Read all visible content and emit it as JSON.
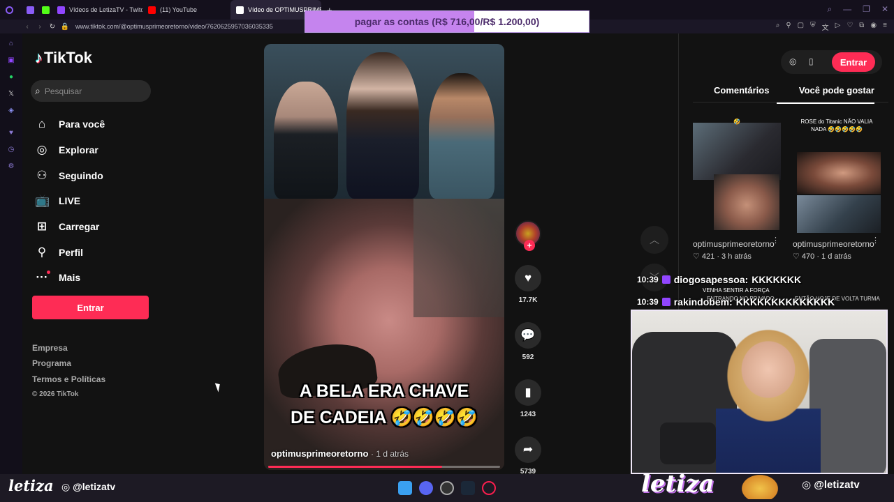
{
  "browser": {
    "tabs": [
      {
        "label": "",
        "color": "#8a5cf6"
      },
      {
        "label": "",
        "color": "#53fc18"
      },
      {
        "label": "Vídeos de LetizaTV - Twitc",
        "color": "#9146ff"
      },
      {
        "label": "(11) YouTube",
        "color": "#ff0000"
      },
      {
        "label": "Vídeo de OPTIMUSPRIME",
        "color": "#ffffff"
      }
    ],
    "url": "www.tiktok.com/@optimusprimeoretorno/video/7620625957036035335"
  },
  "tiktok": {
    "logo": "TikTok",
    "search_placeholder": "Pesquisar",
    "menu": [
      {
        "label": "Para você",
        "icon": "home-icon"
      },
      {
        "label": "Explorar",
        "icon": "compass-icon"
      },
      {
        "label": "Seguindo",
        "icon": "following-icon"
      },
      {
        "label": "LIVE",
        "icon": "live-icon"
      },
      {
        "label": "Carregar",
        "icon": "upload-icon"
      },
      {
        "label": "Perfil",
        "icon": "profile-icon"
      },
      {
        "label": "Mais",
        "icon": "more-icon"
      }
    ],
    "login_label": "Entrar",
    "footer_links": [
      "Empresa",
      "Programa",
      "Termos e Políticas"
    ],
    "copyright": "© 2026 TikTok",
    "accent": "#fe2c55",
    "video": {
      "caption_line1": "A BELA ERA CHAVE",
      "caption_line2": "DE CADEIA 🤣🤣🤣🤣",
      "author": "optimusprimeoretorno",
      "posted": "· 1 d atrás",
      "progress": 0.75
    },
    "actions": {
      "likes": "17.7K",
      "comments": "592",
      "saves": "1243",
      "shares": "5739"
    }
  },
  "right_panel": {
    "login_label": "Entrar",
    "tabs": [
      "Comentários",
      "Você pode gostar"
    ],
    "cards": [
      {
        "title": "🤣",
        "author": "optimusprimeoretorno",
        "stats": "♡ 421 · 3 h atrás"
      },
      {
        "title": "ROSE do Titanic NÃO VALIA NADA 🤣🤣🤣🤣🤣",
        "author": "optimusprimeoretorno",
        "stats": "♡ 470 · 1 d atrás"
      }
    ],
    "hidden_titles": [
      "VENHA SENTIR A FORÇA",
      "ENTRANDO NO PRIVADO",
      "ENTÃO HOJE DE VOLTA TURMA"
    ]
  },
  "overlay": {
    "donation_text": "pagar as contas (R$ 716,00/R$ 1.200,00)",
    "donation_progress": 0.5967,
    "chat": [
      {
        "time": "10:39",
        "user": "diogosapessoa:",
        "message": "KKKKKKK"
      },
      {
        "time": "10:39",
        "user": "rakindobem:",
        "message": "KKKKKKKKKKKKKK"
      }
    ],
    "brand_left": "letiza",
    "handle_left": "@letizatv",
    "brand_right": "letiza",
    "handle_right": "@letizatv"
  }
}
